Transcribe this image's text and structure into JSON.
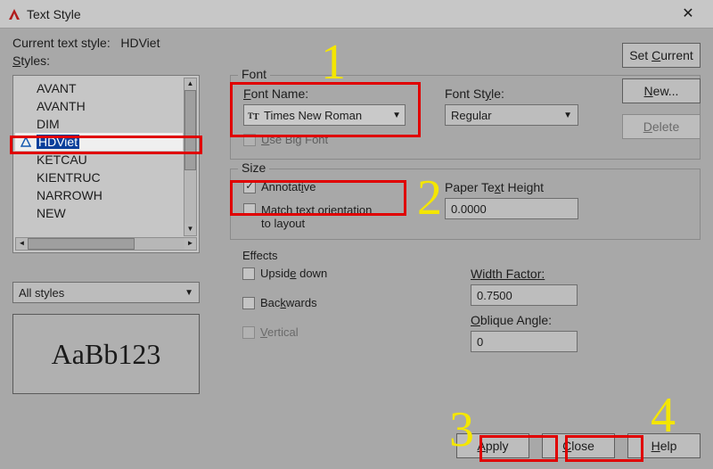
{
  "title": "Text Style",
  "current_style_label": "Current text style:",
  "current_style_value": "HDViet",
  "styles_label": "Styles:",
  "styles": {
    "items": [
      "AVANT",
      "AVANTH",
      "DIM",
      "HDViet",
      "KETCAU",
      "KIENTRUC",
      "NARROWH",
      "NEW"
    ],
    "selected": "HDViet"
  },
  "filter": {
    "value": "All styles"
  },
  "preview": "AaBb123",
  "font": {
    "group_label": "Font",
    "name_label": "Font Name:",
    "name_value": "Times New Roman",
    "use_bigfont_label": "Use Big Font",
    "style_label": "Font Style:",
    "style_value": "Regular"
  },
  "size": {
    "group_label": "Size",
    "annotative_label": "Annotative",
    "annotative_checked": true,
    "match_label": "Match text orientation to layout",
    "match_checked": false,
    "paper_height_label": "Paper Text Height",
    "paper_height_value": "0.0000"
  },
  "effects": {
    "group_label": "Effects",
    "upside_label": "Upside down",
    "backwards_label": "Backwards",
    "vertical_label": "Vertical",
    "width_factor_label": "Width Factor:",
    "width_factor_value": "0.7500",
    "oblique_label": "Oblique Angle:",
    "oblique_value": "0"
  },
  "buttons": {
    "set_current": "Set Current",
    "new": "New...",
    "delete": "Delete",
    "apply": "Apply",
    "close": "Close",
    "help": "Help"
  },
  "annotations": {
    "n1": "1",
    "n2": "2",
    "n3": "3",
    "n4": "4"
  }
}
